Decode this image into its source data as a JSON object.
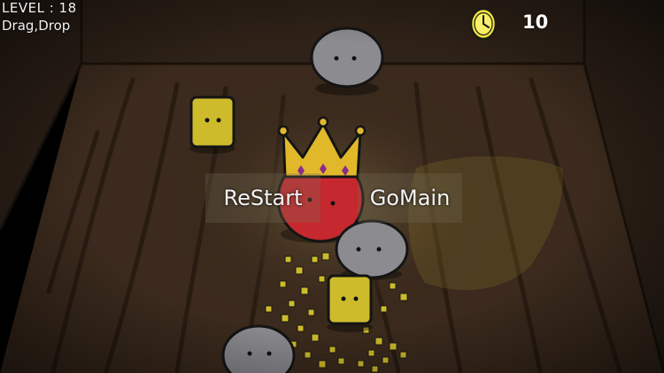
{
  "hud": {
    "level_text": "LEVEL : 18",
    "hint_text": "Drag,Drop",
    "timer_value": "10",
    "timer_icon": "clock-icon"
  },
  "menu": {
    "restart_label": "ReStart",
    "gomain_label": "GoMain"
  },
  "scene": {
    "floor_color": "#3b2a1d",
    "wall_color": "#2f2218",
    "spotlight_color": "#e6cc3c",
    "characters": [
      {
        "name": "rock-creature",
        "color": "#8b8b90"
      },
      {
        "name": "block-creature",
        "color": "#d8c62a"
      },
      {
        "name": "king-creature",
        "color": "#c5282e",
        "crown_color": "#e2b82b"
      }
    ]
  }
}
